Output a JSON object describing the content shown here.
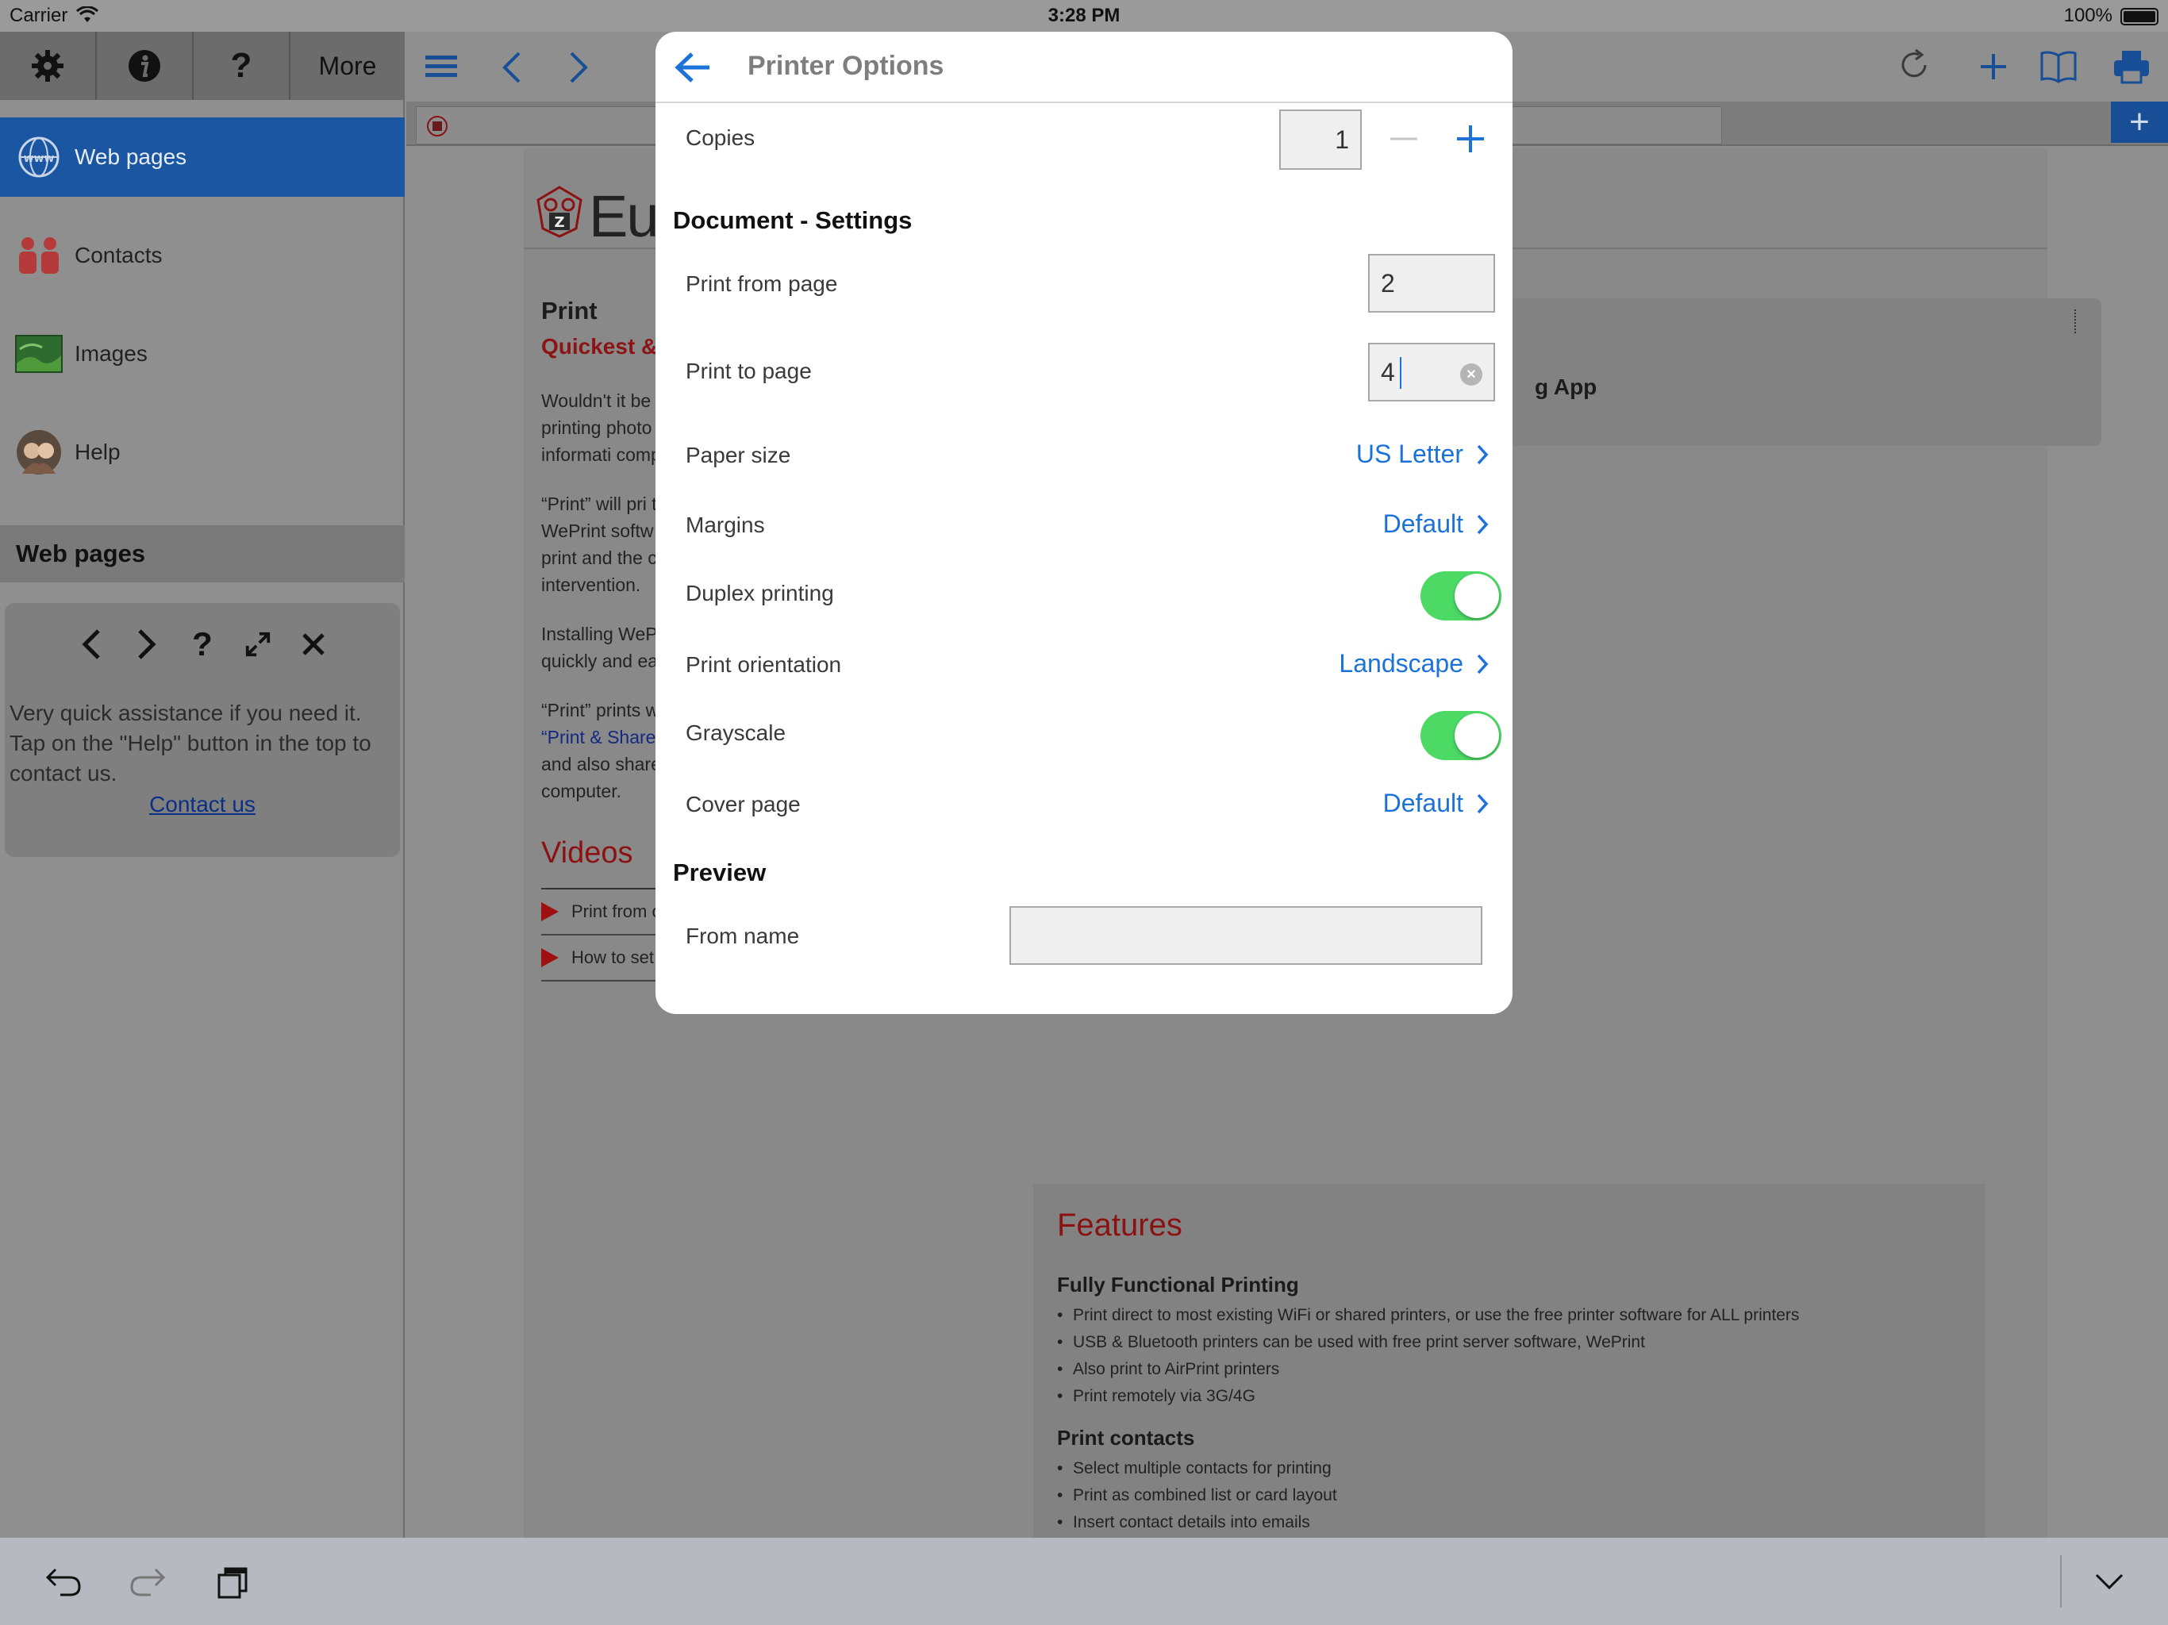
{
  "status_bar": {
    "carrier": "Carrier",
    "time": "3:28 PM",
    "battery": "100%"
  },
  "sidebar": {
    "toolbar": {
      "more_label": "More"
    },
    "items": [
      {
        "label": "Web pages"
      },
      {
        "label": "Contacts"
      },
      {
        "label": "Images"
      },
      {
        "label": "Help"
      }
    ],
    "section_title": "Web pages",
    "assist": {
      "text": "Very quick assistance if you need it. Tap on the \"Help\" button in the top to contact us.",
      "link": "Contact us"
    }
  },
  "webpage": {
    "logo_text": "Eur",
    "title": "Print",
    "subtitle": "Quickest & move",
    "paragraphs": [
      "Wouldn't it be address and p out a web pag printing photo Album? Or ev straight away. print informati computer, via",
      "“Print” will pri to ALL printer Network) via y WePrint softw your Mac or P be near your c print and the c automatically device onto yo intervention.",
      "Installing WeP give you the a when you are quickly and easily send print jobs to your printer."
    ],
    "para4_link": "“Print & Share”",
    "para4_start": "“Print” prints web pages, contacts and images.",
    "para4_end": "also prints emails, stored files and also shares files with your desktop computer.",
    "right_box_text": "g App",
    "videos_title": "Videos",
    "videos": [
      "Print from other browsers",
      "How to set up a new printer"
    ],
    "features_title": "Features",
    "features": [
      {
        "heading": "Fully Functional Printing",
        "items": [
          "Print direct to most existing WiFi or shared printers, or use the free printer software for ALL printers",
          "USB & Bluetooth printers can be used with free print server software, WePrint",
          "Also print to AirPrint printers",
          "Print remotely via 3G/4G"
        ]
      },
      {
        "heading": "Print contacts",
        "items": [
          "Select multiple contacts for printing",
          "Print as combined list or card layout",
          "Insert contact details into emails"
        ]
      }
    ]
  },
  "modal": {
    "title": "Printer Options",
    "copies_label": "Copies",
    "copies_value": "1",
    "document_section": "Document - Settings",
    "print_from_label": "Print from page",
    "print_from_value": "2",
    "print_to_label": "Print to page",
    "print_to_value": "4",
    "paper_size_label": "Paper size",
    "paper_size_value": "US Letter",
    "margins_label": "Margins",
    "margins_value": "Default",
    "duplex_label": "Duplex printing",
    "duplex_on": true,
    "orientation_label": "Print orientation",
    "orientation_value": "Landscape",
    "grayscale_label": "Grayscale",
    "grayscale_on": true,
    "cover_label": "Cover page",
    "cover_value": "Default",
    "preview_section": "Preview",
    "from_name_label": "From name",
    "from_name_value": ""
  },
  "colors": {
    "accent": "#1b72d8",
    "toggle_on": "#4cd964",
    "sidebar_selected": "#1a56a2",
    "brand_red": "#8b1212"
  }
}
